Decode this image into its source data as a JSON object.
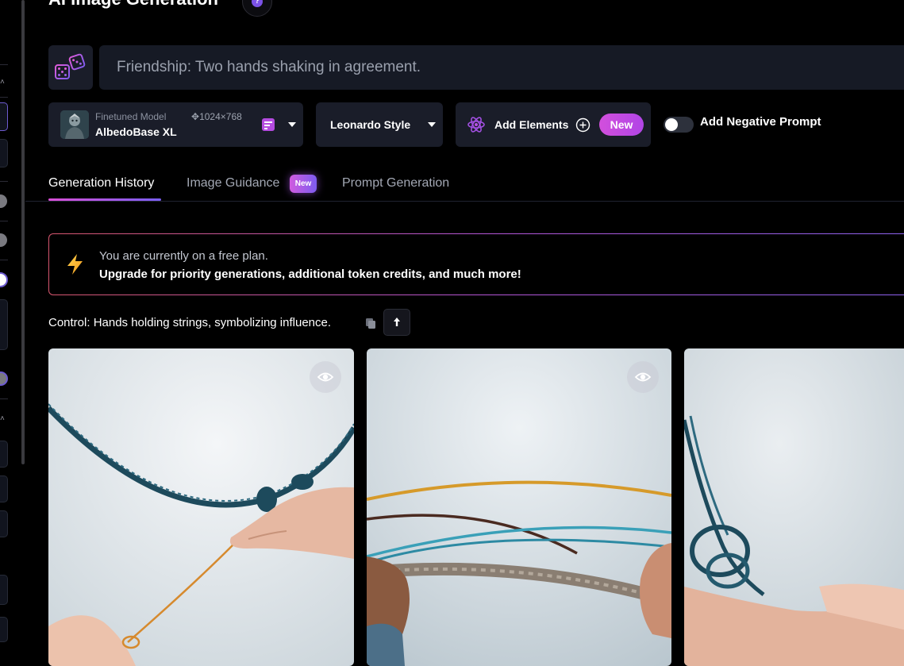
{
  "header": {
    "title": "AI Image Generation",
    "help_icon": "question-icon"
  },
  "prompt": {
    "value": "Friendship: Two hands shaking in agreement.",
    "random_icon": "dice-icon"
  },
  "model": {
    "caption": "Finetuned Model",
    "name": "AlbedoBase XL",
    "dimensions": "1024×768"
  },
  "style": {
    "label": "Leonardo Style"
  },
  "elements": {
    "label": "Add Elements",
    "badge": "New"
  },
  "negative_prompt": {
    "label": "Add Negative Prompt",
    "enabled": false
  },
  "tabs": [
    {
      "label": "Generation History",
      "active": true
    },
    {
      "label": "Image Guidance",
      "badge": "New",
      "active": false
    },
    {
      "label": "Prompt Generation",
      "active": false
    }
  ],
  "banner": {
    "line1": "You are currently on a free plan.",
    "line2": "Upgrade for priority generations, additional token credits, and much more!"
  },
  "generation": {
    "prompt": "Control: Hands holding strings, symbolizing influence."
  },
  "colors": {
    "accent_pink": "#d24fdc",
    "accent_purple": "#7b52e6",
    "panel": "#1a1d29",
    "prompt_bg": "#161a25"
  }
}
